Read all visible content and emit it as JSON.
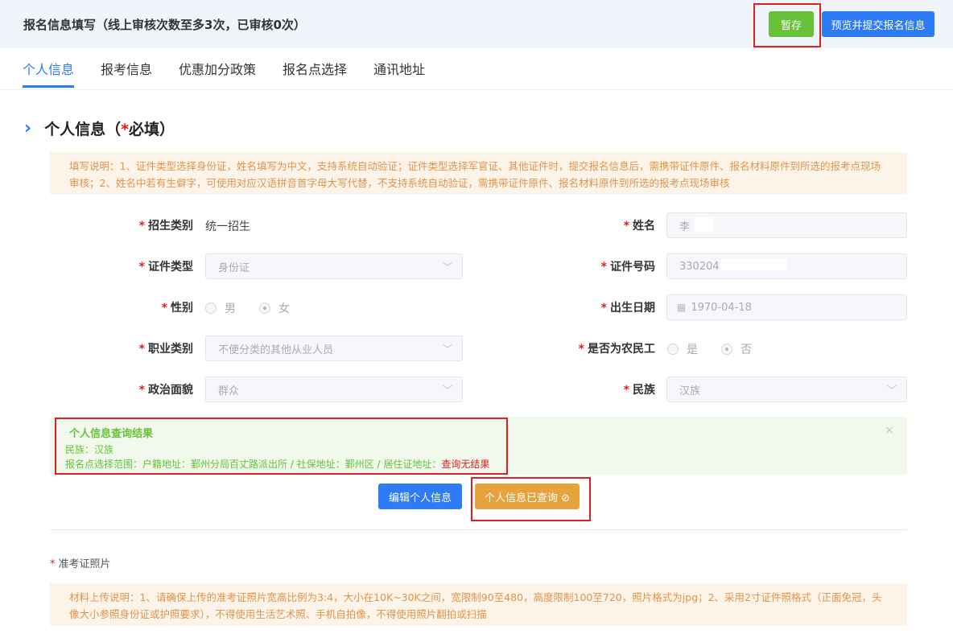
{
  "header": {
    "title": "报名信息填写（线上审核次数至多3次，已审核0次）",
    "save_label": "暂存",
    "submit_label": "预览并提交报名信息"
  },
  "tabs": [
    {
      "label": "个人信息",
      "active": true
    },
    {
      "label": "报考信息",
      "active": false
    },
    {
      "label": "优惠加分政策",
      "active": false
    },
    {
      "label": "报名点选择",
      "active": false
    },
    {
      "label": "通讯地址",
      "active": false
    }
  ],
  "section": {
    "title_prefix": "个人信息（",
    "star": "*",
    "title_suffix": "必填）",
    "icon": "chevron-right-icon"
  },
  "notice1": "填写说明：1、证件类型选择身份证，姓名填写为中文，支持系统自动验证；证件类型选择军官证、其他证件时，提交报名信息后，需携带证件原件、报名材料原件到所选的报考点现场审核；2、姓名中若有生僻字，可使用对应汉语拼音首字母大写代替，不支持系统自动验证，需携带证件原件、报名材料原件到所选的报考点现场审核",
  "form": {
    "required_mark": "*",
    "recruit_type": {
      "label": "招生类别",
      "value": "统一招生"
    },
    "name": {
      "label": "姓名",
      "value": "李"
    },
    "id_type": {
      "label": "证件类型",
      "value": "身份证"
    },
    "id_number": {
      "label": "证件号码",
      "value": "330204"
    },
    "gender": {
      "label": "性别",
      "options": [
        "男",
        "女"
      ],
      "selected": "女"
    },
    "birth_date": {
      "label": "出生日期",
      "value": "1970-04-18"
    },
    "occupation": {
      "label": "职业类别",
      "value": "不便分类的其他从业人员"
    },
    "migrant_worker": {
      "label": "是否为农民工",
      "options": [
        "是",
        "否"
      ],
      "selected": "否"
    },
    "political": {
      "label": "政治面貌",
      "value": "群众"
    },
    "ethnicity": {
      "label": "民族",
      "value": "汉族"
    }
  },
  "result": {
    "title": "个人信息查询结果",
    "line1": "民族：汉族",
    "line2_prefix": "报名点选择范围：户籍地址：鄞州分局百丈路派出所 / 社保地址：鄞州区 / 居住证地址：",
    "line2_bad": "查询无结果",
    "close": "×"
  },
  "actions": {
    "edit_label": "编辑个人信息",
    "queried_label": "个人信息已查询 ⊘"
  },
  "photo": {
    "label": "准考证照片",
    "notice": "材料上传说明：1、请确保上传的准考证照片宽高比例为3:4，大小在10K~30K之间，宽限制90至480，高度限制100至720，照片格式为jpg；2、采用2寸证件照格式（正面免冠，头像大小参照身份证或护照要求），不得使用生活艺术照、手机自拍像，不得使用照片翻拍或扫描"
  },
  "colors": {
    "primary": "#2d7bf5",
    "success": "#67c23a",
    "warning": "#e6a23c",
    "danger": "#e02020"
  }
}
